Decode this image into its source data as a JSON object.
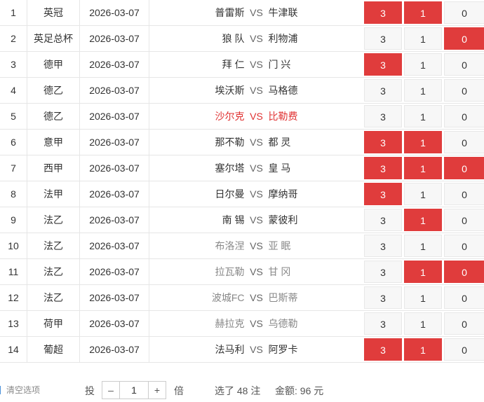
{
  "vs_label": "VS",
  "rows": [
    {
      "no": "1",
      "league": "英冠",
      "date": "2026-03-07",
      "home": "普雷斯",
      "away": "牛津联",
      "style": "",
      "opts": [
        "3",
        "1",
        "0"
      ],
      "sel": [
        true,
        true,
        false
      ]
    },
    {
      "no": "2",
      "league": "英足总杯",
      "date": "2026-03-07",
      "home": "狼 队",
      "away": "利物浦",
      "style": "",
      "opts": [
        "3",
        "1",
        "0"
      ],
      "sel": [
        false,
        false,
        true
      ]
    },
    {
      "no": "3",
      "league": "德甲",
      "date": "2026-03-07",
      "home": "拜 仁",
      "away": "门 兴",
      "style": "",
      "opts": [
        "3",
        "1",
        "0"
      ],
      "sel": [
        true,
        false,
        false
      ]
    },
    {
      "no": "4",
      "league": "德乙",
      "date": "2026-03-07",
      "home": "埃沃斯",
      "away": "马格德",
      "style": "",
      "opts": [
        "3",
        "1",
        "0"
      ],
      "sel": [
        false,
        false,
        false
      ]
    },
    {
      "no": "5",
      "league": "德乙",
      "date": "2026-03-07",
      "home": "沙尔克",
      "away": "比勒费",
      "style": "hot",
      "opts": [
        "3",
        "1",
        "0"
      ],
      "sel": [
        false,
        false,
        false
      ]
    },
    {
      "no": "6",
      "league": "意甲",
      "date": "2026-03-07",
      "home": "那不勒",
      "away": "都 灵",
      "style": "",
      "opts": [
        "3",
        "1",
        "0"
      ],
      "sel": [
        true,
        true,
        false
      ]
    },
    {
      "no": "7",
      "league": "西甲",
      "date": "2026-03-07",
      "home": "塞尔塔",
      "away": "皇 马",
      "style": "",
      "opts": [
        "3",
        "1",
        "0"
      ],
      "sel": [
        true,
        true,
        true
      ]
    },
    {
      "no": "8",
      "league": "法甲",
      "date": "2026-03-07",
      "home": "日尔曼",
      "away": "摩纳哥",
      "style": "",
      "opts": [
        "3",
        "1",
        "0"
      ],
      "sel": [
        true,
        false,
        false
      ]
    },
    {
      "no": "9",
      "league": "法乙",
      "date": "2026-03-07",
      "home": "南 锡",
      "away": "蒙彼利",
      "style": "",
      "opts": [
        "3",
        "1",
        "0"
      ],
      "sel": [
        false,
        true,
        false
      ]
    },
    {
      "no": "10",
      "league": "法乙",
      "date": "2026-03-07",
      "home": "布洛涅",
      "away": "亚 眠",
      "style": "dim",
      "opts": [
        "3",
        "1",
        "0"
      ],
      "sel": [
        false,
        false,
        false
      ]
    },
    {
      "no": "11",
      "league": "法乙",
      "date": "2026-03-07",
      "home": "拉瓦勒",
      "away": "甘 冈",
      "style": "dim",
      "opts": [
        "3",
        "1",
        "0"
      ],
      "sel": [
        false,
        true,
        true
      ]
    },
    {
      "no": "12",
      "league": "法乙",
      "date": "2026-03-07",
      "home": "波城FC",
      "away": "巴斯蒂",
      "style": "dim",
      "opts": [
        "3",
        "1",
        "0"
      ],
      "sel": [
        false,
        false,
        false
      ]
    },
    {
      "no": "13",
      "league": "荷甲",
      "date": "2026-03-07",
      "home": "赫拉克",
      "away": "乌德勒",
      "style": "dim",
      "opts": [
        "3",
        "1",
        "0"
      ],
      "sel": [
        false,
        false,
        false
      ]
    },
    {
      "no": "14",
      "league": "葡超",
      "date": "2026-03-07",
      "home": "法马利",
      "away": "阿罗卡",
      "style": "",
      "opts": [
        "3",
        "1",
        "0"
      ],
      "sel": [
        true,
        true,
        false
      ]
    }
  ],
  "colors": {
    "selected": "#e03c3c",
    "hot_team": "#e03131",
    "dim_team": "#888888"
  },
  "footer": {
    "clear_label": "清空选项",
    "clear_icon": "trash-icon",
    "multiplier_label": "投",
    "minus_label": "–",
    "multiplier_value": "1",
    "plus_label": "+",
    "times_label": "倍",
    "selection_summary": "选了 48 注",
    "amount_text": "金额:  96 元"
  }
}
